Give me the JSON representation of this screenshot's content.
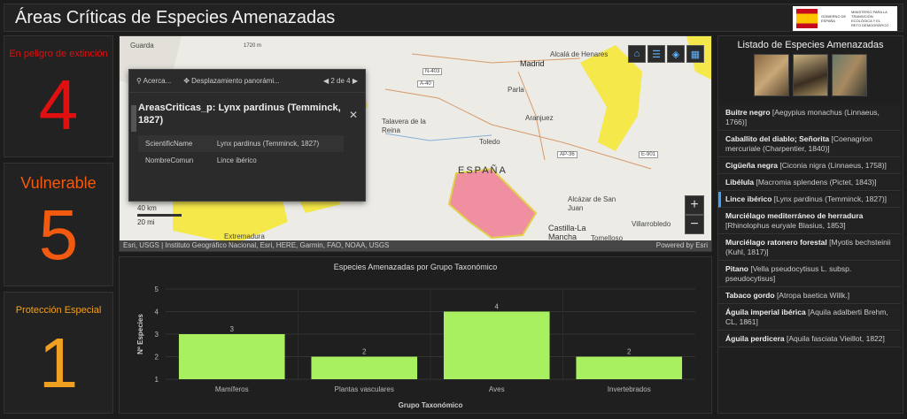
{
  "header": {
    "title": "Áreas Críticas de Especies Amenazadas"
  },
  "logo": {
    "line1": "GOBIERNO DE ESPAÑA",
    "line2": "MINISTERIO PARA LA TRANSICIÓN ECOLÓGICA Y EL RETO DEMOGRÁFICO"
  },
  "cards": [
    {
      "label": "En peligro de extinción",
      "value": "4",
      "color": "#e01010"
    },
    {
      "label": "Vulnerable",
      "value": "5",
      "color": "#f25a10"
    },
    {
      "label": "Protección Especial",
      "value": "1",
      "color": "#f0a020"
    }
  ],
  "map": {
    "places": [
      "Guarda",
      "Madrid",
      "Alcalá de Henares",
      "Parla",
      "Aranjuez",
      "Talavera de la Reina",
      "Toledo",
      "ESPAÑA",
      "Alcázar de San Juan",
      "Villarrobledo",
      "Castilla-La Mancha",
      "Tomelloso",
      "Extremadura",
      "A-40",
      "E-901",
      "AP-36",
      "N-403",
      "1720 m"
    ],
    "attribution": "Esri, USGS | Instituto Geográfico Nacional, Esri, HERE, Garmin, FAO, NOAA, USGS",
    "powered": "Powered by Esri",
    "scale": {
      "km": "40 km",
      "mi": "20 mi"
    },
    "popup": {
      "zoom_label": "Acerca...",
      "pan_label": "Desplazamiento panorámi...",
      "page": "2 de 4",
      "title": "AreasCriticas_p: Lynx pardinus (Temminck, 1827)",
      "fields": [
        {
          "key": "ScientificName",
          "value": "Lynx pardinus (Temminck, 1827)"
        },
        {
          "key": "NombreComun",
          "value": "Lince ibérico"
        }
      ]
    }
  },
  "chart": {
    "title": "Especies Amenazadas por Grupo Taxonómico",
    "xlabel": "Grupo Taxonómico",
    "ylabel": "Nº Especies"
  },
  "chart_data": {
    "type": "bar",
    "title": "Especies Amenazadas por Grupo Taxonómico",
    "categories": [
      "Mamíferos",
      "Plantas vasculares",
      "Aves",
      "Invertebrados"
    ],
    "values": [
      3,
      2,
      4,
      2
    ],
    "xlabel": "Grupo Taxonómico",
    "ylabel": "Nº Especies",
    "ylim": [
      1,
      5
    ],
    "yticks": [
      1,
      2,
      3,
      4,
      5
    ],
    "bar_color": "#a8f060",
    "grid": true
  },
  "side": {
    "title": "Listado de Especies Amenazadas",
    "items": [
      {
        "name": "Buitre negro",
        "sci": "[Aegypius monachus (Linnaeus, 1766)]"
      },
      {
        "name": "Caballito del diablo; Señorita",
        "sci": "[Coenagrion mercuriale (Charpentier, 1840)]"
      },
      {
        "name": "Cigüeña negra",
        "sci": "[Ciconia nigra (Linnaeus, 1758)]"
      },
      {
        "name": "Libélula",
        "sci": "[Macromia splendens (Pictet, 1843)]"
      },
      {
        "name": "Lince ibérico",
        "sci": "[Lynx pardinus (Temminck, 1827)]"
      },
      {
        "name": "Murciélago mediterráneo de herradura",
        "sci": "[Rhinolophus euryale Blasius, 1853]"
      },
      {
        "name": "Murciélago ratonero forestal",
        "sci": "[Myotis bechsteinii (Kuhl, 1817)]"
      },
      {
        "name": "Pitano",
        "sci": "[Vella pseudocytisus L. subsp. pseudocytisus]"
      },
      {
        "name": "Tabaco gordo",
        "sci": "[Atropa baetica Willk.]"
      },
      {
        "name": "Águila imperial ibérica",
        "sci": "[Aquila adalberti Brehm, CL, 1861]"
      },
      {
        "name": "Águila perdicera",
        "sci": "[Aquila fasciata Vieillot, 1822]"
      }
    ]
  }
}
